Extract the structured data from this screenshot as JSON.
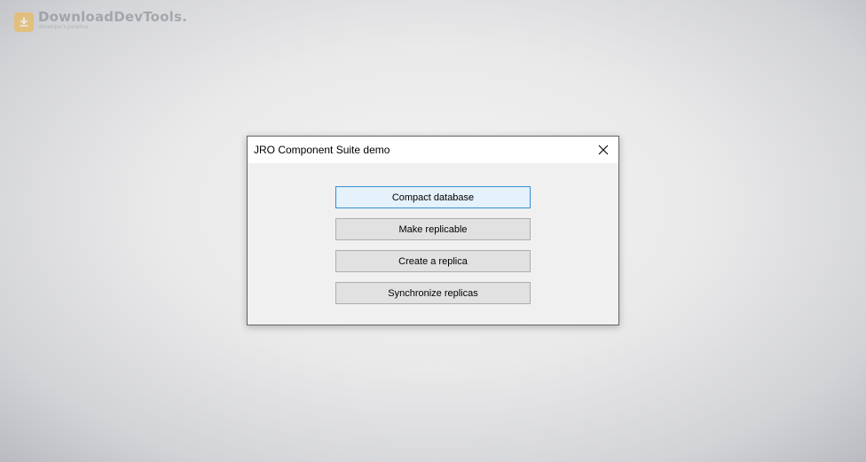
{
  "watermark": {
    "title": "DownloadDevTools.",
    "tagline": "developer's paradise"
  },
  "dialog": {
    "title": "JRO Component Suite demo",
    "close_icon": "close-icon",
    "buttons": [
      {
        "label": "Compact database"
      },
      {
        "label": "Make replicable"
      },
      {
        "label": "Create a replica"
      },
      {
        "label": "Synchronize replicas"
      }
    ]
  },
  "colors": {
    "default_button_border": "#2f8fd7",
    "default_button_bg": "#e5f1fb",
    "button_bg": "#e1e1e1",
    "logo": "#f3b43a"
  }
}
